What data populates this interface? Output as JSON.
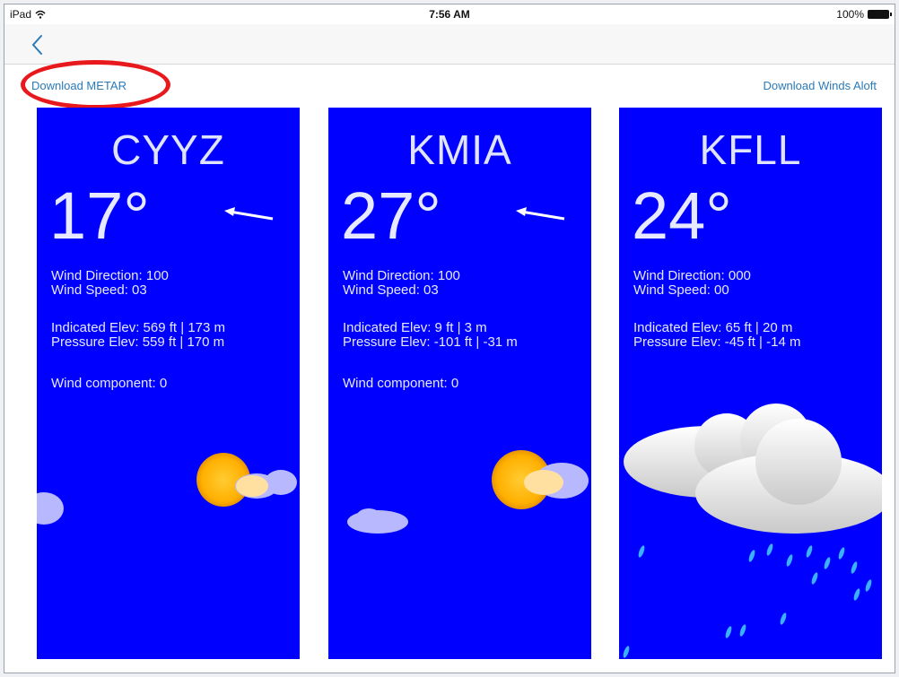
{
  "status": {
    "device": "iPad",
    "time": "7:56 AM",
    "battery": "100%"
  },
  "toolbar": {
    "download_metar": "Download METAR",
    "download_winds_aloft": "Download Winds Aloft"
  },
  "stations": [
    {
      "code": "CYYZ",
      "temp": "17°",
      "wind_direction": "Wind Direction: 100",
      "wind_speed": "Wind Speed: 03",
      "indicated_elev": "Indicated Elev: 569 ft | 173 m",
      "pressure_elev": "Pressure Elev: 559 ft | 170 m",
      "wind_component": "Wind component: 0",
      "weather_icon": "sun-cloud-icon"
    },
    {
      "code": "KMIA",
      "temp": "27°",
      "wind_direction": "Wind Direction: 100",
      "wind_speed": "Wind Speed: 03",
      "indicated_elev": "Indicated Elev: 9 ft | 3 m",
      "pressure_elev": "Pressure Elev: -101 ft | -31 m",
      "wind_component": "Wind component: 0",
      "weather_icon": "sun-cloud-icon"
    },
    {
      "code": "KFLL",
      "temp": "24°",
      "wind_direction": "Wind Direction: 000",
      "wind_speed": "Wind Speed: 00",
      "indicated_elev": "Indicated Elev: 65 ft | 20 m",
      "pressure_elev": "Pressure Elev: -45 ft | -14 m",
      "weather_icon": "rain-cloud-icon"
    }
  ],
  "colors": {
    "card_bg": "#0000ff",
    "link": "#2a7ab8",
    "highlight": "#e8191c"
  }
}
